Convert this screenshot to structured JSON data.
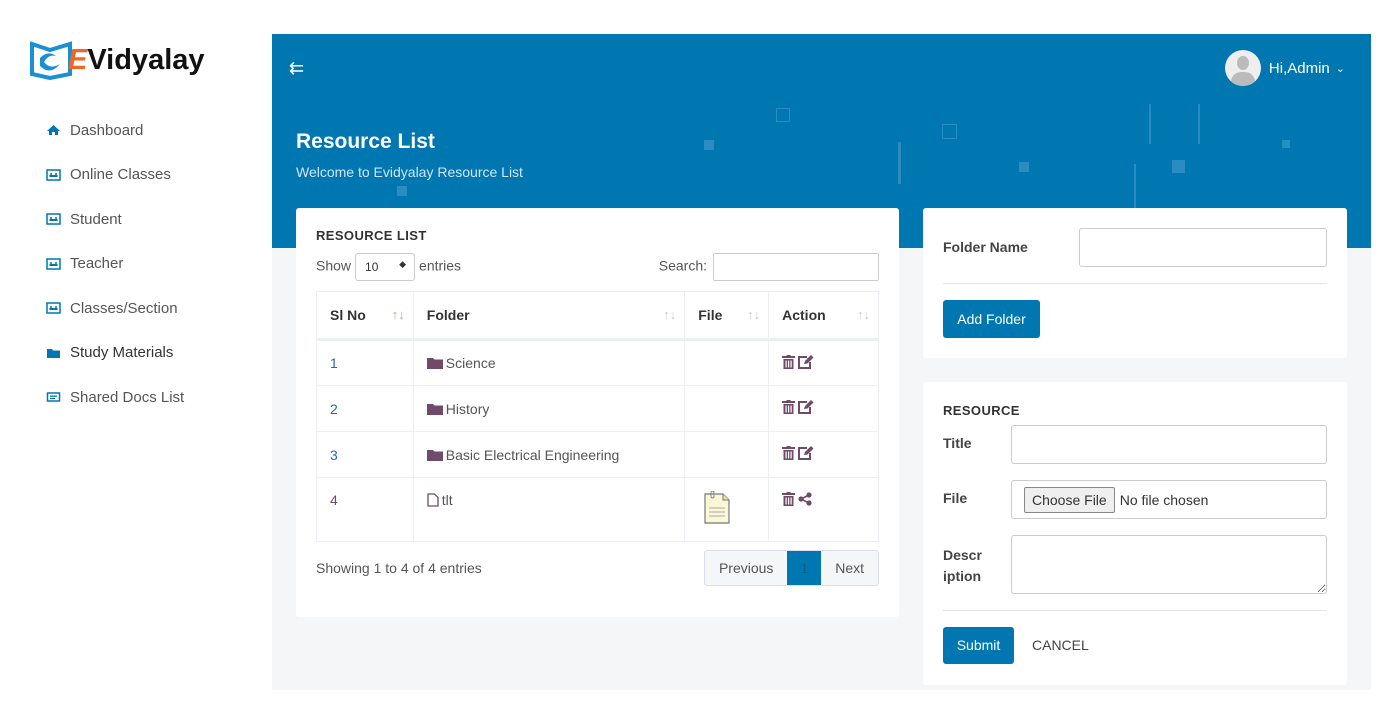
{
  "brand": {
    "logo_text_e": "E",
    "logo_text_rest": "Vidyalay"
  },
  "sidebar": {
    "items": [
      {
        "label": "Dashboard",
        "icon": "home-icon"
      },
      {
        "label": "Online Classes",
        "icon": "presentation-icon"
      },
      {
        "label": "Student",
        "icon": "presentation-icon"
      },
      {
        "label": "Teacher",
        "icon": "presentation-icon"
      },
      {
        "label": "Classes/Section",
        "icon": "presentation-icon"
      },
      {
        "label": "Study Materials",
        "icon": "folder-icon",
        "active": true
      },
      {
        "label": "Shared Docs List",
        "icon": "id-card-icon"
      }
    ]
  },
  "header": {
    "greeting": "Hi,Admin",
    "title": "Resource List",
    "subtitle": "Welcome to Evidyalay Resource List"
  },
  "list": {
    "heading": "RESOURCE LIST",
    "show_label": "Show",
    "entries_value": "10",
    "entries_label": "entries",
    "search_label": "Search:",
    "columns": [
      "Sl No",
      "Folder",
      "File",
      "Action"
    ],
    "rows": [
      {
        "no": "1",
        "name": "Science",
        "type": "folder"
      },
      {
        "no": "2",
        "name": "History",
        "type": "folder"
      },
      {
        "no": "3",
        "name": "Basic Electrical Engineering",
        "type": "folder"
      },
      {
        "no": "4",
        "name": "tlt",
        "type": "file"
      }
    ],
    "info": "Showing 1 to 4 of 4 entries",
    "prev": "Previous",
    "page": "1",
    "next": "Next"
  },
  "folder_form": {
    "label": "Folder Name",
    "value": "",
    "button": "Add Folder"
  },
  "resource_form": {
    "heading": "RESOURCE",
    "title_label": "Title",
    "file_label": "File",
    "choose_file": "Choose File",
    "no_file": "No file chosen",
    "desc_label_1": "Descr",
    "desc_label_2": "iption",
    "submit": "Submit",
    "cancel": "CANCEL"
  },
  "colors": {
    "primary": "#0077b1",
    "icon": "#704a68"
  }
}
